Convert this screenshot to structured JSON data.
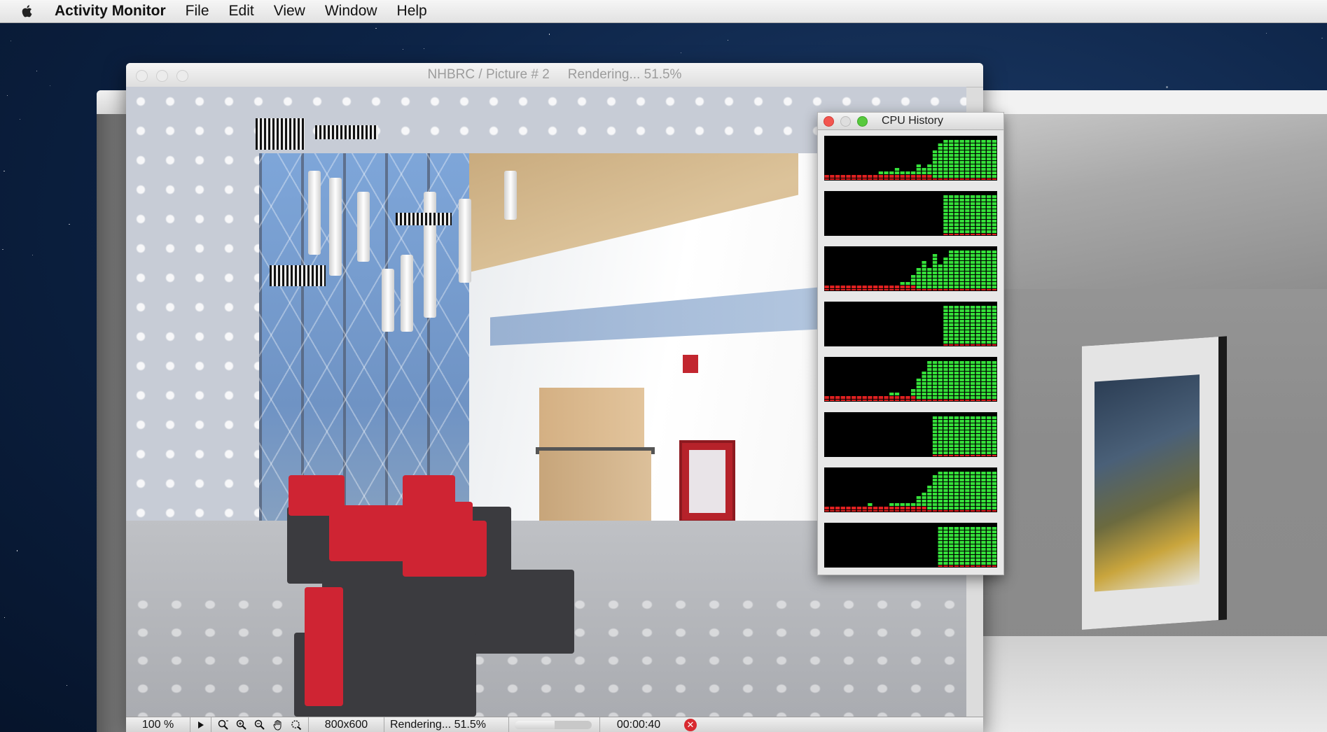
{
  "menubar": {
    "app_name": "Activity Monitor",
    "items": [
      "File",
      "Edit",
      "View",
      "Window",
      "Help"
    ]
  },
  "render_window": {
    "title": "NHBRC / Picture # 2",
    "title_status": "Rendering... 51.5%"
  },
  "status_bar": {
    "zoom": "100 %",
    "resolution": "800x600",
    "status_text": "Rendering... 51.5%",
    "progress": 0.515,
    "elapsed": "00:00:40",
    "icons": [
      "play-icon",
      "zoom-fit-icon",
      "zoom-in-icon",
      "zoom-out-icon",
      "pan-hand-icon",
      "zoom-region-icon",
      "stop-icon"
    ]
  },
  "cpu_history": {
    "title": "CPU History",
    "cores": [
      {
        "name": "core-1",
        "levels": [
          0.05,
          0.05,
          0.05,
          0.06,
          0.06,
          0.07,
          0.08,
          0.08,
          0.1,
          0.12,
          0.15,
          0.18,
          0.2,
          0.22,
          0.2,
          0.15,
          0.2,
          0.3,
          0.25,
          0.35,
          0.7,
          0.85,
          0.9,
          0.95,
          0.95,
          0.95,
          0.95,
          0.95,
          0.95,
          0.95,
          0.95,
          0.95
        ]
      },
      {
        "name": "core-2",
        "levels": [
          0,
          0,
          0,
          0,
          0,
          0,
          0,
          0,
          0,
          0,
          0,
          0,
          0,
          0,
          0,
          0,
          0,
          0,
          0,
          0,
          0,
          0,
          0.95,
          0.95,
          0.95,
          0.95,
          0.95,
          0.95,
          0.95,
          0.95,
          0.95,
          0.95
        ]
      },
      {
        "name": "core-3",
        "levels": [
          0.05,
          0.05,
          0.05,
          0.05,
          0.06,
          0.06,
          0.06,
          0.07,
          0.07,
          0.08,
          0.1,
          0.1,
          0.1,
          0.12,
          0.15,
          0.2,
          0.3,
          0.5,
          0.7,
          0.5,
          0.8,
          0.6,
          0.75,
          0.9,
          0.95,
          0.9,
          0.95,
          0.95,
          0.95,
          0.95,
          0.95,
          0.95
        ]
      },
      {
        "name": "core-4",
        "levels": [
          0,
          0,
          0,
          0,
          0,
          0,
          0,
          0,
          0,
          0,
          0,
          0,
          0,
          0,
          0,
          0,
          0,
          0,
          0,
          0,
          0,
          0,
          0.95,
          0.95,
          0.95,
          0.95,
          0.95,
          0.95,
          0.95,
          0.95,
          0.95,
          0.95
        ]
      },
      {
        "name": "core-5",
        "levels": [
          0.05,
          0.05,
          0.05,
          0.05,
          0.05,
          0.05,
          0.06,
          0.06,
          0.07,
          0.1,
          0.1,
          0.12,
          0.15,
          0.15,
          0.1,
          0.12,
          0.25,
          0.5,
          0.7,
          0.9,
          0.95,
          0.95,
          0.95,
          0.95,
          0.95,
          0.95,
          0.95,
          0.95,
          0.95,
          0.95,
          0.95,
          0.95
        ]
      },
      {
        "name": "core-6",
        "levels": [
          0,
          0,
          0,
          0,
          0,
          0,
          0,
          0,
          0,
          0,
          0,
          0,
          0,
          0,
          0,
          0,
          0,
          0,
          0,
          0,
          0.95,
          0.95,
          0.95,
          0.95,
          0.95,
          0.95,
          0.95,
          0.95,
          0.95,
          0.95,
          0.95,
          0.95
        ]
      },
      {
        "name": "core-7",
        "levels": [
          0.08,
          0.08,
          0.1,
          0.1,
          0.12,
          0.1,
          0.1,
          0.12,
          0.15,
          0.12,
          0.1,
          0.12,
          0.15,
          0.18,
          0.2,
          0.15,
          0.2,
          0.3,
          0.4,
          0.55,
          0.8,
          0.9,
          0.9,
          0.95,
          0.95,
          0.95,
          0.95,
          0.95,
          0.95,
          0.95,
          0.95,
          0.95
        ]
      },
      {
        "name": "core-8",
        "levels": [
          0,
          0,
          0,
          0,
          0,
          0,
          0,
          0,
          0,
          0,
          0,
          0,
          0,
          0,
          0,
          0,
          0,
          0,
          0,
          0,
          0,
          0.95,
          0.95,
          0.95,
          0.95,
          0.95,
          0.95,
          0.95,
          0.95,
          0.95,
          0.95,
          0.95
        ]
      }
    ],
    "colors": {
      "user": "#35e03a",
      "system": "#e02020",
      "background": "#000000"
    }
  }
}
